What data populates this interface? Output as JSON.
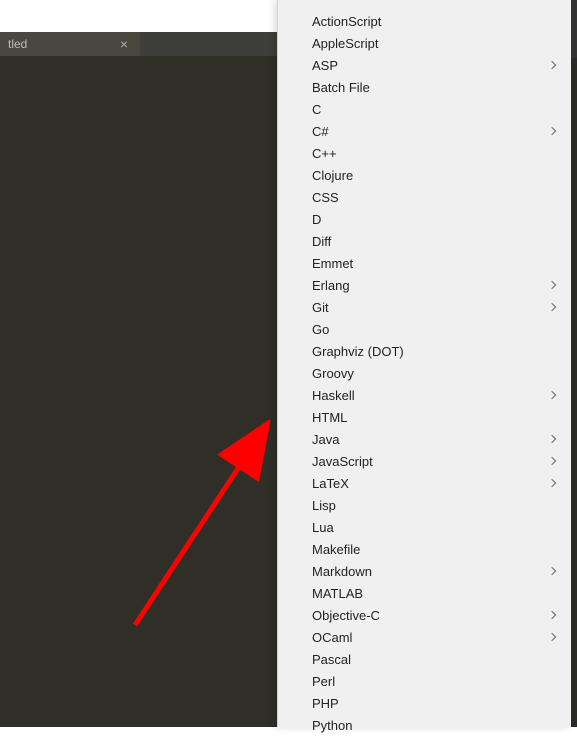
{
  "tab": {
    "label": "tled",
    "close": "×"
  },
  "menu": {
    "items": [
      {
        "label": "ActionScript",
        "hasSubmenu": false
      },
      {
        "label": "AppleScript",
        "hasSubmenu": false
      },
      {
        "label": "ASP",
        "hasSubmenu": true
      },
      {
        "label": "Batch File",
        "hasSubmenu": false
      },
      {
        "label": "C",
        "hasSubmenu": false
      },
      {
        "label": "C#",
        "hasSubmenu": true
      },
      {
        "label": "C++",
        "hasSubmenu": false
      },
      {
        "label": "Clojure",
        "hasSubmenu": false
      },
      {
        "label": "CSS",
        "hasSubmenu": false
      },
      {
        "label": "D",
        "hasSubmenu": false
      },
      {
        "label": "Diff",
        "hasSubmenu": false
      },
      {
        "label": "Emmet",
        "hasSubmenu": false
      },
      {
        "label": "Erlang",
        "hasSubmenu": true
      },
      {
        "label": "Git",
        "hasSubmenu": true
      },
      {
        "label": "Go",
        "hasSubmenu": false
      },
      {
        "label": "Graphviz (DOT)",
        "hasSubmenu": false
      },
      {
        "label": "Groovy",
        "hasSubmenu": false
      },
      {
        "label": "Haskell",
        "hasSubmenu": true
      },
      {
        "label": "HTML",
        "hasSubmenu": false
      },
      {
        "label": "Java",
        "hasSubmenu": true
      },
      {
        "label": "JavaScript",
        "hasSubmenu": true
      },
      {
        "label": "LaTeX",
        "hasSubmenu": true
      },
      {
        "label": "Lisp",
        "hasSubmenu": false
      },
      {
        "label": "Lua",
        "hasSubmenu": false
      },
      {
        "label": "Makefile",
        "hasSubmenu": false
      },
      {
        "label": "Markdown",
        "hasSubmenu": true
      },
      {
        "label": "MATLAB",
        "hasSubmenu": false
      },
      {
        "label": "Objective-C",
        "hasSubmenu": true
      },
      {
        "label": "OCaml",
        "hasSubmenu": true
      },
      {
        "label": "Pascal",
        "hasSubmenu": false
      },
      {
        "label": "Perl",
        "hasSubmenu": false
      },
      {
        "label": "PHP",
        "hasSubmenu": false
      },
      {
        "label": "Python",
        "hasSubmenu": false
      }
    ]
  }
}
